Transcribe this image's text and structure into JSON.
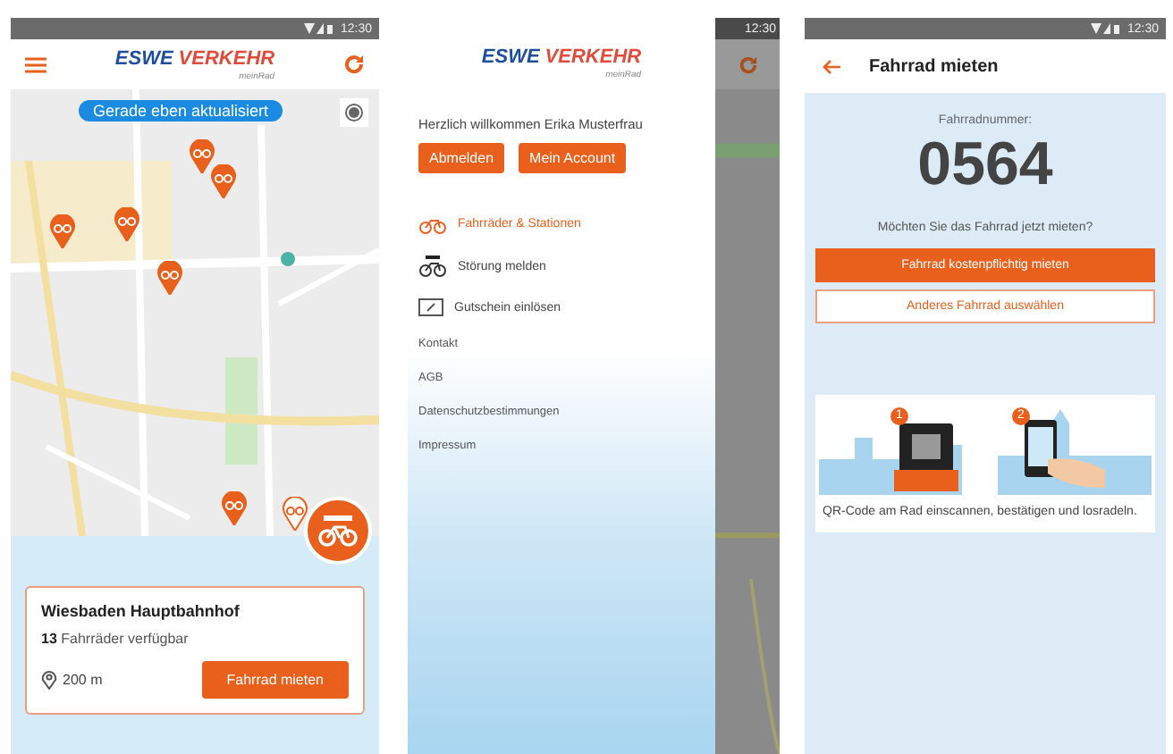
{
  "screens": [
    {
      "kind": "map",
      "status_time": "12:30",
      "logo": {
        "brand": "ESWE",
        "name": "VERKEHR",
        "sub": "meinRad"
      },
      "badge": "Gerade eben aktualisiert",
      "station": {
        "name": "Wiesbaden Hauptbahnhof",
        "count": "13",
        "available": "Fahrräder verfügbar",
        "distance": "200 m",
        "button": "Fahrrad mieten"
      }
    },
    {
      "kind": "drawer",
      "status_time": "12:30",
      "logo": {
        "brand": "ESWE",
        "name": "VERKEHR",
        "sub": "meinRad"
      },
      "welcome": "Herzlich willkommen Erika Musterfrau",
      "buttons": [
        "Abmelden",
        "Mein Account"
      ],
      "menu": [
        {
          "label": "Fahrräder & Stationen",
          "selected": true
        },
        {
          "label": "Störung melden",
          "selected": false
        },
        {
          "label": "Gutschein einlösen",
          "selected": false
        }
      ],
      "links": [
        "Kontakt",
        "AGB",
        "Datenschutzbestimmungen",
        "Impressum"
      ]
    },
    {
      "kind": "rent",
      "status_time": "12:30",
      "title": "Fahrrad mieten",
      "number_label": "Fahrradnummer:",
      "number": "0564",
      "question": "Möchten Sie das Fahrrad jetzt mieten?",
      "primary": "Fahrrad kostenpflichtig mieten",
      "secondary": "Anderes Fahrrad auswählen",
      "steps": [
        "1",
        "2"
      ],
      "hint": "QR-Code am Rad einscannen, bestätigen und losradeln."
    }
  ]
}
